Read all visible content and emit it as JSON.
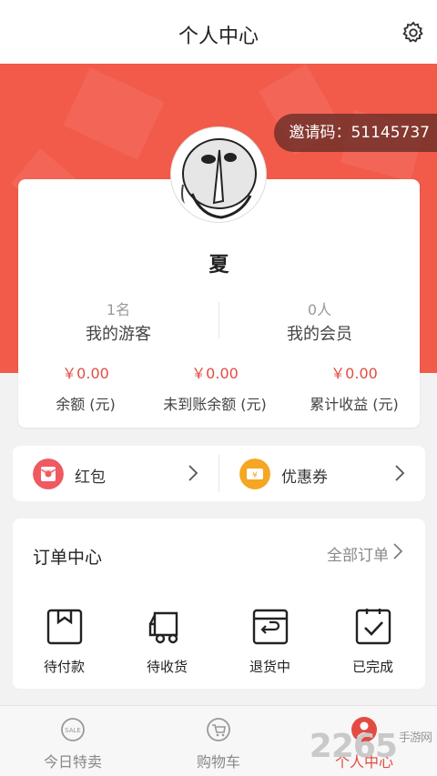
{
  "header": {
    "title": "个人中心",
    "settings_icon": "gear-icon"
  },
  "colors": {
    "accent": "#f25a49",
    "money": "#e34b42",
    "invite_bg": "#5a2823"
  },
  "invite": {
    "text": "邀请码：51145737"
  },
  "profile": {
    "avatar_icon": "meme-face-avatar",
    "username": "夏",
    "stats": [
      {
        "count": "1名",
        "label": "我的游客"
      },
      {
        "count": "0人",
        "label": "我的会员"
      }
    ],
    "money": [
      {
        "amount": "￥0.00",
        "label": "余额 (元)"
      },
      {
        "amount": "￥0.00",
        "label": "未到账余额 (元)"
      },
      {
        "amount": "￥0.00",
        "label": "累计收益 (元)"
      }
    ]
  },
  "coupons": [
    {
      "label": "红包",
      "icon": "red-envelope-icon"
    },
    {
      "label": "优惠券",
      "icon": "coupon-icon"
    }
  ],
  "orders": {
    "title": "订单中心",
    "all_label": "全部订单",
    "items": [
      {
        "label": "待付款",
        "icon": "wallet-icon"
      },
      {
        "label": "待收货",
        "icon": "truck-icon"
      },
      {
        "label": "退货中",
        "icon": "return-box-icon"
      },
      {
        "label": "已完成",
        "icon": "check-clipboard-icon"
      }
    ]
  },
  "tabbar": [
    {
      "label": "今日特卖",
      "icon": "sale-badge-icon",
      "active": false
    },
    {
      "label": "购物车",
      "icon": "cart-icon",
      "active": false
    },
    {
      "label": "个人中心",
      "icon": "user-icon",
      "active": true
    }
  ],
  "watermark": {
    "text": "2265",
    "sub": "手游网"
  }
}
